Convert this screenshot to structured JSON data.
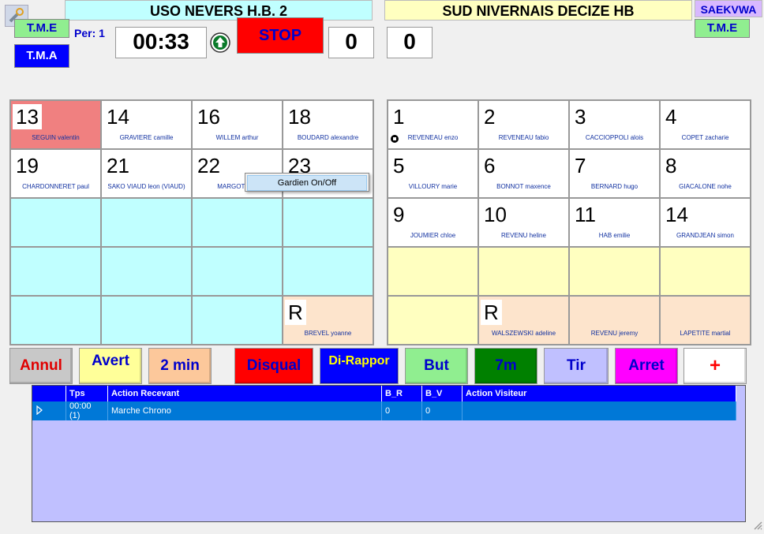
{
  "home": {
    "name": "USO NEVERS H.B. 2",
    "tme_label": "T.M.E",
    "tma_label": "T.M.A",
    "period_label": "Per: 1",
    "score": "0",
    "players": [
      {
        "num": "13",
        "name": "SEGUIN valentin",
        "state": "excluded"
      },
      {
        "num": "14",
        "name": "GRAVIERE camille"
      },
      {
        "num": "16",
        "name": "WILLEM arthur"
      },
      {
        "num": "18",
        "name": "BOUDARD alexandre"
      },
      {
        "num": "19",
        "name": "CHARDONNERET paul"
      },
      {
        "num": "21",
        "name": "SAKO VIAUD leon (VIAUD)"
      },
      {
        "num": "22",
        "name": "MARGOT ada"
      },
      {
        "num": "23",
        "name": ""
      },
      {
        "num": "",
        "name": ""
      },
      {
        "num": "",
        "name": ""
      },
      {
        "num": "",
        "name": ""
      },
      {
        "num": "",
        "name": ""
      },
      {
        "num": "",
        "name": ""
      },
      {
        "num": "",
        "name": ""
      },
      {
        "num": "",
        "name": ""
      },
      {
        "num": "",
        "name": ""
      },
      {
        "num": "",
        "name": ""
      },
      {
        "num": "",
        "name": ""
      },
      {
        "num": "",
        "name": ""
      },
      {
        "num": "R",
        "name": "BREVEL yoanne",
        "state": "official"
      }
    ]
  },
  "visitor": {
    "name": "SUD NIVERNAIS DECIZE HB",
    "code": "SAEKVWA",
    "tme_label": "T.M.E",
    "score": "0",
    "players": [
      {
        "num": "1",
        "name": "REVENEAU enzo",
        "goalkeeper": true
      },
      {
        "num": "2",
        "name": "REVENEAU fabio"
      },
      {
        "num": "3",
        "name": "CACCIOPPOLI alois"
      },
      {
        "num": "4",
        "name": "COPET zacharie"
      },
      {
        "num": "5",
        "name": "VILLOURY marie"
      },
      {
        "num": "6",
        "name": "BONNOT maxence"
      },
      {
        "num": "7",
        "name": "BERNARD hugo"
      },
      {
        "num": "8",
        "name": "GIACALONE nohe"
      },
      {
        "num": "9",
        "name": "JOUMIER chloe"
      },
      {
        "num": "10",
        "name": "REVENU heline"
      },
      {
        "num": "11",
        "name": "HAB emilie"
      },
      {
        "num": "14",
        "name": "GRANDJEAN simon"
      },
      {
        "num": "",
        "name": ""
      },
      {
        "num": "",
        "name": ""
      },
      {
        "num": "",
        "name": ""
      },
      {
        "num": "",
        "name": ""
      },
      {
        "num": "",
        "name": ""
      },
      {
        "num": "R",
        "name": "WALSZEWSKI adeline",
        "state": "official"
      },
      {
        "num": "",
        "name": "REVENU jeremy",
        "state": "official"
      },
      {
        "num": "",
        "name": "LAPETITE martial",
        "state": "official"
      }
    ]
  },
  "clock": {
    "time": "00:33",
    "stop_label": "STOP"
  },
  "context_menu": {
    "item": "Gardien On/Off"
  },
  "actions": [
    {
      "label": "Annul",
      "bg": "#c8c8c8",
      "fg": "#e00000"
    },
    {
      "label": "Avert",
      "bg": "#ffff99",
      "fg": "#0000cc"
    },
    {
      "label": "2 min",
      "bg": "#fcc89b",
      "fg": "#0000cc"
    },
    {
      "label": "Disqual",
      "bg": "#ff0000",
      "fg": "#0000cc"
    },
    {
      "label": "Di-Rappor",
      "bg": "#0000ff",
      "fg": "#ffff00"
    },
    {
      "label": "But",
      "bg": "#90ee90",
      "fg": "#0000cc"
    },
    {
      "label": "7m",
      "bg": "#008000",
      "fg": "#0000cc"
    },
    {
      "label": "Tir",
      "bg": "#c0c0ff",
      "fg": "#0000cc"
    },
    {
      "label": "Arret",
      "bg": "#ff00ff",
      "fg": "#0000cc"
    },
    {
      "label": "+",
      "bg": "#ffffff",
      "fg": "#ff0000"
    }
  ],
  "log": {
    "headers": [
      "Tps",
      "Action Recevant",
      "B_R",
      "B_V",
      "Action Visiteur"
    ],
    "rows": [
      {
        "tps": "00:00 (1)",
        "action_recevant": "Marche Chrono",
        "b_r": "0",
        "b_v": "0",
        "action_visiteur": ""
      }
    ]
  },
  "colors": {
    "home_bg": "#c0ffff",
    "visitor_bg": "#ffffc0",
    "excluded_bg": "#f08080",
    "official_bg": "#fde4cc",
    "log_bg": "#c0c0ff"
  }
}
